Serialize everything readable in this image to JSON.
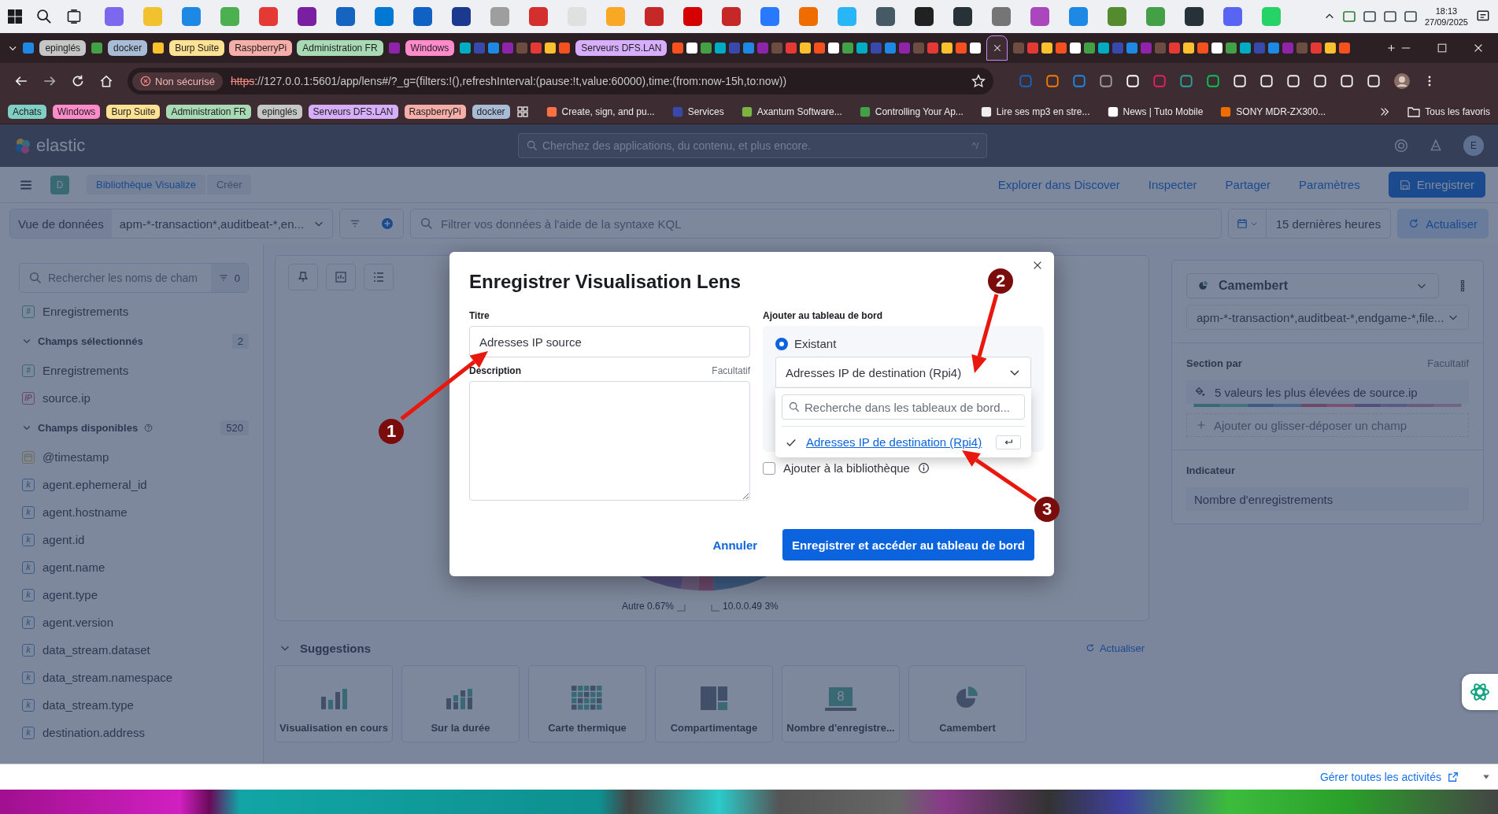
{
  "taskbar": {
    "time": "18:13",
    "date": "27/09/2025"
  },
  "tab_strip": [
    {
      "kind": "favicons"
    },
    {
      "kind": "group",
      "label": "epinglés",
      "color": "#c4c7c5"
    },
    {
      "kind": "favicons"
    },
    {
      "kind": "group",
      "label": "docker",
      "color": "#a8bcd6"
    },
    {
      "kind": "favicons"
    },
    {
      "kind": "group",
      "label": "Burp Suite",
      "color": "#fde293"
    },
    {
      "kind": "group",
      "label": "RaspberryPi",
      "color": "#f6aea9"
    },
    {
      "kind": "group",
      "label": "Administration FR",
      "color": "#a8dab5"
    },
    {
      "kind": "favicons"
    },
    {
      "kind": "group",
      "label": "Windows",
      "color": "#ff8bcb"
    },
    {
      "kind": "favicons"
    },
    {
      "kind": "group",
      "label": "Serveurs DFS.LAN",
      "color": "#d7aefb"
    },
    {
      "kind": "favicons"
    },
    {
      "kind": "active_tab"
    },
    {
      "kind": "favicons"
    }
  ],
  "address_bar": {
    "security": "Non sécurisé",
    "url_scheme": "https",
    "url_rest": "://127.0.0.1:5601/app/lens#/?_g=(filters:!(),refreshInterval:(pause:!t,value:60000),time:(from:now-15h,to:now))"
  },
  "bookmark_groups": [
    {
      "label": "Achats",
      "color": "#7fcfc4"
    },
    {
      "label": "Windows",
      "color": "#ff8bcb"
    },
    {
      "label": "Burp Suite",
      "color": "#fde293"
    },
    {
      "label": "Administration FR",
      "color": "#a8dab5"
    },
    {
      "label": "epinglés",
      "color": "#c4c7c5"
    },
    {
      "label": "Serveurs DFS.LAN",
      "color": "#d7aefb"
    },
    {
      "label": "RaspberryPi",
      "color": "#f6aea9"
    },
    {
      "label": "docker",
      "color": "#a8bcd6"
    }
  ],
  "bookmarks": [
    {
      "label": "Create, sign, and pu..."
    },
    {
      "label": "Services"
    },
    {
      "label": "Axantum Software..."
    },
    {
      "label": "Controlling Your Ap..."
    },
    {
      "label": "Lire ses mp3 en stre..."
    },
    {
      "label": "News | Tuto Mobile"
    },
    {
      "label": "SONY MDR-ZX300..."
    }
  ],
  "all_bookmarks": "Tous les favoris",
  "kibana_header": {
    "logo": "elastic",
    "search_placeholder": "Cherchez des applications, du contenu, et plus encore.",
    "shortcut": "^/",
    "avatar": "E"
  },
  "nav": {
    "space": "D",
    "breadcrumbs": [
      "Bibliothèque Visualize",
      "Créer"
    ],
    "links": [
      "Explorer dans Discover",
      "Inspecter",
      "Partager",
      "Paramètres"
    ],
    "save": "Enregistrer"
  },
  "query_bar": {
    "data_view_label": "Vue de données",
    "data_view": "apm-*-transaction*,auditbeat-*,en...",
    "placeholder": "Filtrer vos données à l'aide de la syntaxe KQL",
    "time_range": "15 dernières heures",
    "refresh": "Actualiser"
  },
  "sidebar": {
    "search_placeholder": "Rechercher les noms de cham",
    "filter_count": "0",
    "top_fields": [
      {
        "name": "Enregistrements",
        "kind": "number",
        "badge": "#"
      }
    ],
    "sections": [
      {
        "title": "Champs sélectionnés",
        "count": "2",
        "expanded": true,
        "help": false,
        "fields": [
          {
            "name": "Enregistrements",
            "kind": "number",
            "badge": "#"
          },
          {
            "name": "source.ip",
            "kind": "ip",
            "badge": "IP"
          }
        ]
      },
      {
        "title": "Champs disponibles",
        "count": "520",
        "expanded": true,
        "help": true,
        "fields": [
          {
            "name": "@timestamp",
            "kind": "date"
          },
          {
            "name": "agent.ephemeral_id",
            "kind": "keyword",
            "badge": "k"
          },
          {
            "name": "agent.hostname",
            "kind": "keyword",
            "badge": "k"
          },
          {
            "name": "agent.id",
            "kind": "keyword",
            "badge": "k"
          },
          {
            "name": "agent.name",
            "kind": "keyword",
            "badge": "k"
          },
          {
            "name": "agent.type",
            "kind": "keyword",
            "badge": "k"
          },
          {
            "name": "agent.version",
            "kind": "keyword",
            "badge": "k"
          },
          {
            "name": "data_stream.dataset",
            "kind": "keyword",
            "badge": "k"
          },
          {
            "name": "data_stream.namespace",
            "kind": "keyword",
            "badge": "k"
          },
          {
            "name": "data_stream.type",
            "kind": "keyword",
            "badge": "k"
          },
          {
            "name": "destination.address",
            "kind": "keyword",
            "badge": "k"
          }
        ]
      }
    ]
  },
  "chart": {
    "labels": [
      "Autre 0.67%",
      "10.0.0.49 3%"
    ]
  },
  "suggestions": {
    "title": "Suggestions",
    "expanded": true,
    "refresh": "Actualiser",
    "cards": [
      {
        "kind": "bar",
        "label": "Visualisation en cours"
      },
      {
        "kind": "stacked",
        "label": "Sur la durée"
      },
      {
        "kind": "heatmap",
        "label": "Carte thermique"
      },
      {
        "kind": "treemap",
        "label": "Compartimentage"
      },
      {
        "kind": "metric",
        "label": "Nombre d'enregistre...",
        "icon_text": "8"
      },
      {
        "kind": "pie",
        "label": "Camembert"
      }
    ]
  },
  "config_panel": {
    "chart_type": "Camembert",
    "data_view": "apm-*-transaction*,auditbeat-*,endgame-*,file...",
    "groups": [
      {
        "title": "Section par",
        "optional": "Facultatif",
        "dimension": "5 valeurs les plus élevées de source.ip",
        "add": "Ajouter ou glisser-déposer un champ"
      },
      {
        "title": "Indicateur",
        "dimension": "Nombre d'enregistrements"
      }
    ]
  },
  "modal": {
    "title": "Enregistrer Visualisation Lens",
    "title_label": "Titre",
    "title_value": "Adresses IP source",
    "description_label": "Description",
    "description_optional": "Facultatif",
    "dashboard_label": "Ajouter au tableau de bord",
    "dashboard_options": [
      {
        "label": "Existant",
        "selected": true
      }
    ],
    "dashboard_value": "Adresses IP de destination (Rpi4)",
    "dropdown_open": true,
    "dropdown_search_placeholder": "Recherche dans les tableaux de bord...",
    "dropdown_items": [
      {
        "label": "Adresses IP de destination (Rpi4)",
        "selected": true
      }
    ],
    "library": {
      "label": "Ajouter à la bibliothèque",
      "checked": false
    },
    "cancel": "Annuler",
    "confirm": "Enregistrer et accéder au tableau de bord"
  },
  "annotations": [
    {
      "label": "1"
    },
    {
      "label": "2"
    },
    {
      "label": "3"
    }
  ],
  "activity_bar": {
    "link": "Gérer toutes les activités"
  }
}
